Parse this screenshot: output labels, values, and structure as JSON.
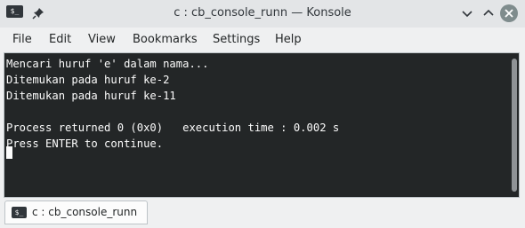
{
  "window": {
    "title": "c : cb_console_runn — Konsole",
    "icon": "konsole-terminal-icon"
  },
  "menu": {
    "items": [
      "File",
      "Edit",
      "View",
      "Bookmarks",
      "Settings",
      "Help"
    ]
  },
  "terminal": {
    "lines": [
      "Mencari huruf 'e' dalam nama...",
      "Ditemukan pada huruf ke-2",
      "Ditemukan pada huruf ke-11",
      "",
      "Process returned 0 (0x0)   execution time : 0.002 s",
      "Press ENTER to continue."
    ],
    "background": "#232627",
    "foreground": "#fcfcfc"
  },
  "tabs": [
    {
      "label": "c : cb_console_runn",
      "icon": "terminal-icon",
      "active": true
    }
  ],
  "colors": {
    "titlebar": "#e3e5e7",
    "window_bg": "#eff0f1",
    "close_button": "#7f8c8d"
  }
}
